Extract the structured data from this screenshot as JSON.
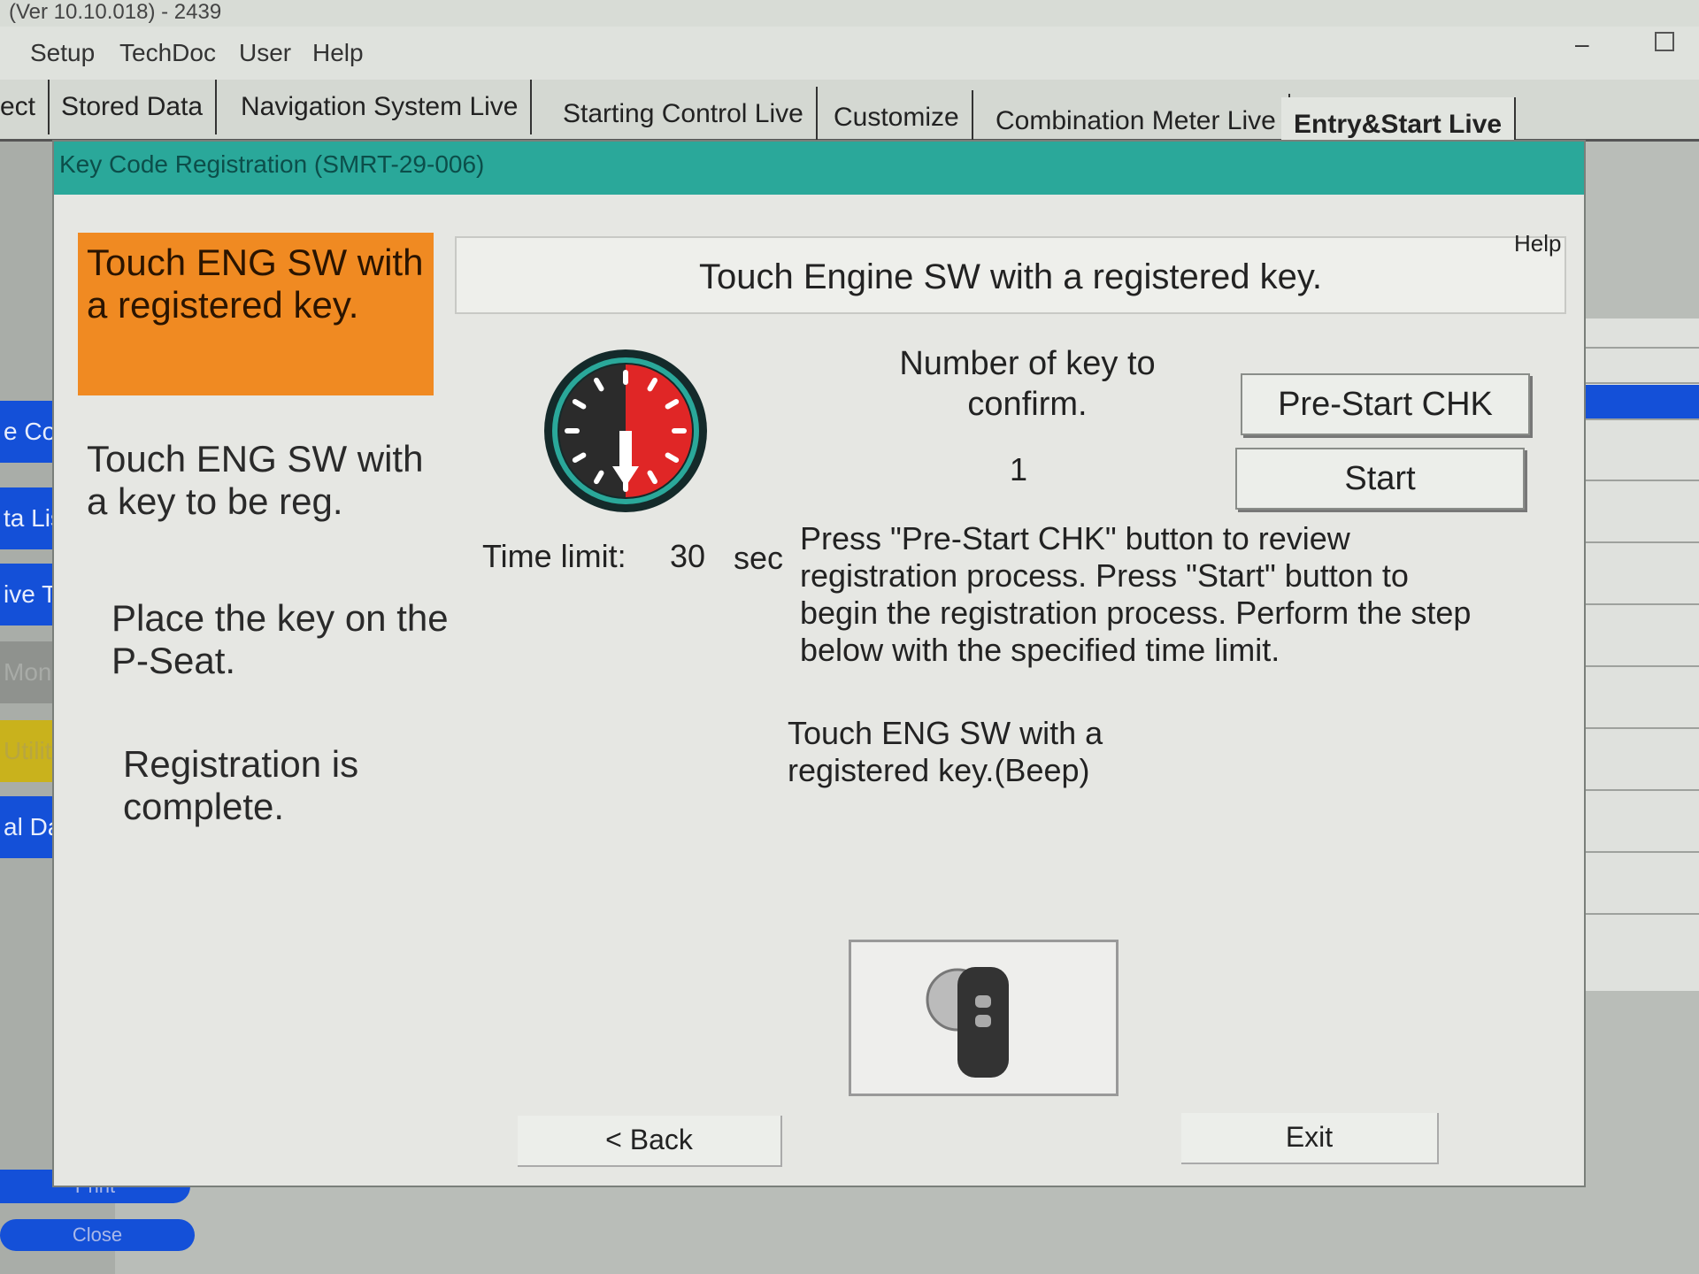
{
  "window": {
    "title": "(Ver 10.10.018) - 2439"
  },
  "menu": [
    "Setup",
    "TechDoc",
    "User",
    "Help"
  ],
  "tabs": [
    {
      "label": "ect"
    },
    {
      "label": "Stored Data"
    },
    {
      "label": "Navigation System Live"
    },
    {
      "label": "Starting Control Live"
    },
    {
      "label": "Customize"
    },
    {
      "label": "Combination Meter Live"
    },
    {
      "label": "Entry&Start Live",
      "active": true
    }
  ],
  "leftnav": {
    "items": [
      "e Code",
      "ta List",
      "ive Test",
      "Monitor",
      "Utility",
      "al Data List"
    ],
    "print": "Print",
    "close": "Close"
  },
  "dialog": {
    "title": "Key Code Registration (SMRT-29-006)",
    "steps": [
      {
        "text": "Touch ENG SW with a registered key.",
        "current": true
      },
      {
        "text": "Touch ENG SW with a key to be reg."
      },
      {
        "text": "Place the key on the P-Seat."
      },
      {
        "text": "Registration is complete."
      }
    ],
    "help": "Help",
    "instruction": "Touch Engine SW with a registered key.",
    "key_count_label": "Number of key to confirm.",
    "key_count": "1",
    "time_limit_label": "Time limit:",
    "time_limit_value": "30",
    "time_limit_unit": "sec",
    "prestart_button": "Pre-Start CHK",
    "start_button": "Start",
    "description": "Press \"Pre-Start CHK\" button to review registration process. Press \"Start\" button to begin the registration process. Perform the step below with the specified time limit.",
    "step_hint": "Touch ENG SW with a registered key.(Beep)",
    "back_button": "< Back",
    "exit_button": "Exit"
  },
  "colors": {
    "accent": "#2aa89a",
    "current_step": "#f08a22",
    "nav_blue": "#1450d8",
    "timer_red": "#e02626"
  }
}
